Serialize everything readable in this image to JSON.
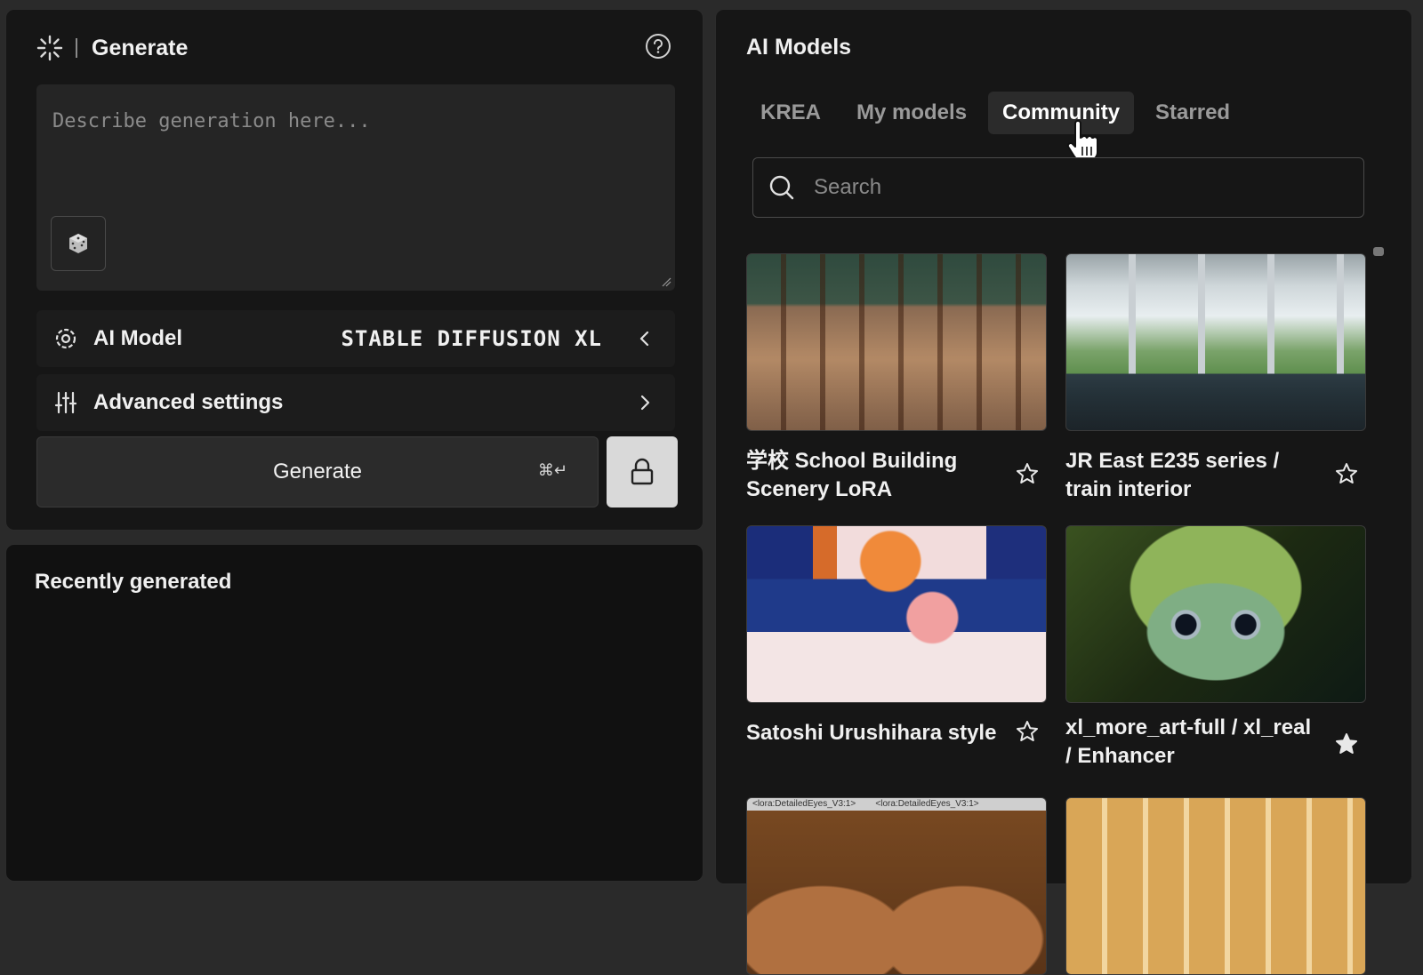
{
  "generate_panel": {
    "title": "Generate",
    "prompt_placeholder": "Describe generation here...",
    "ai_model_label": "AI Model",
    "ai_model_value": "STABLE DIFFUSION XL",
    "advanced_settings_label": "Advanced settings",
    "generate_button_label": "Generate",
    "generate_shortcut": "⌘↵"
  },
  "recent_panel": {
    "title": "Recently generated"
  },
  "models_panel": {
    "title": "AI Models",
    "tabs": [
      {
        "label": "KREA",
        "active": false
      },
      {
        "label": "My models",
        "active": false
      },
      {
        "label": "Community",
        "active": true
      },
      {
        "label": "Starred",
        "active": false
      }
    ],
    "search_placeholder": "Search",
    "cards": [
      {
        "title": "学校 School Building Scenery LoRA",
        "starred": false
      },
      {
        "title": "JR East E235 series / train interior",
        "starred": false
      },
      {
        "title": "Satoshi Urushihara style",
        "starred": false
      },
      {
        "title": "xl_more_art-full / xl_real / Enhancer",
        "starred": true
      },
      {
        "thumb_text": [
          "<lora:DetailedEyes_V3:1>",
          "<lora:DetailedEyes_V3:1>"
        ]
      },
      {}
    ]
  }
}
